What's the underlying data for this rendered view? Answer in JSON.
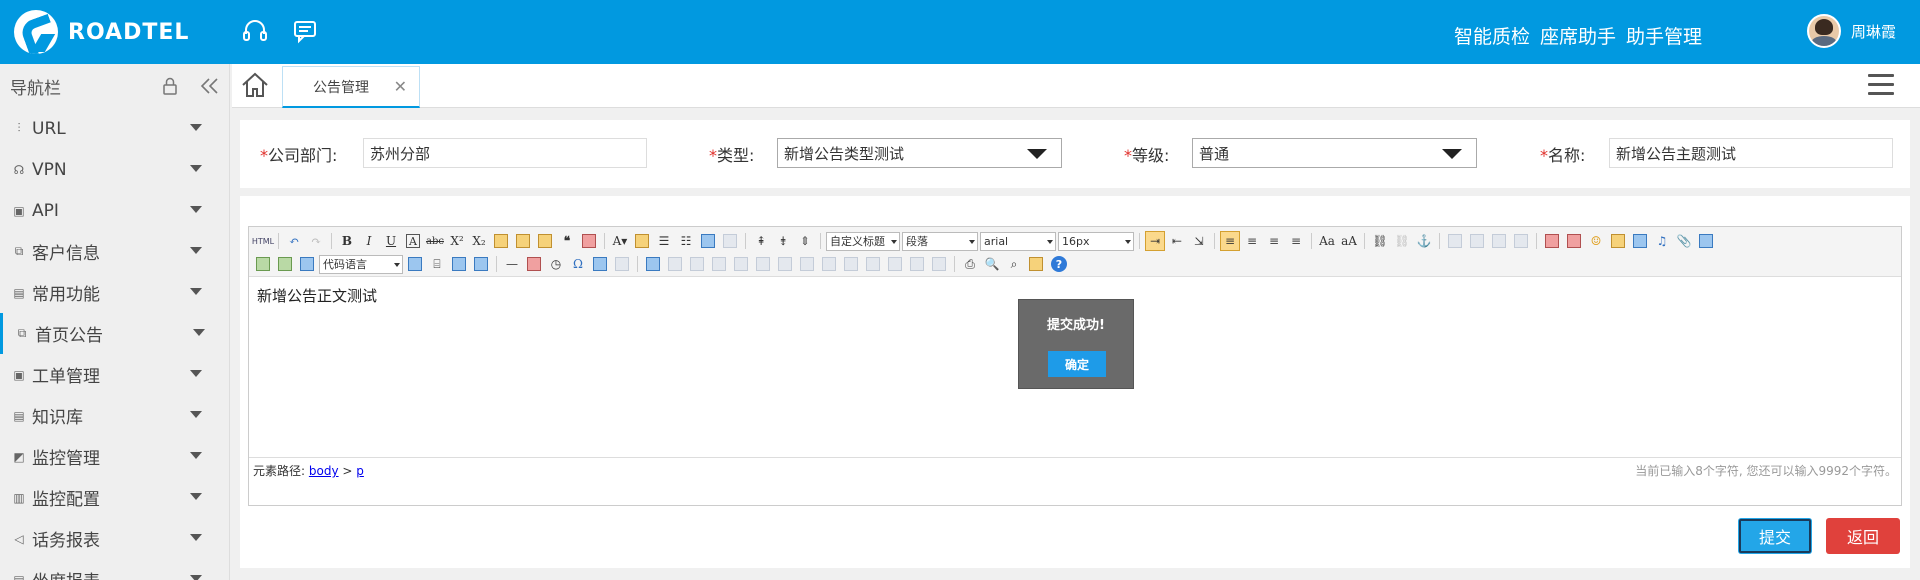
{
  "header": {
    "brand": "ROADTEL",
    "nav": [
      "智能质检",
      "座席助手",
      "助手管理"
    ],
    "user_name": "周琳霞"
  },
  "sidebar": {
    "title": "导航栏",
    "items": [
      {
        "label": "URL",
        "icon": "sliders-icon"
      },
      {
        "label": "VPN",
        "icon": "headset-icon"
      },
      {
        "label": "API",
        "icon": "image-icon"
      },
      {
        "label": "客户信息",
        "icon": "cards-icon"
      },
      {
        "label": "常用功能",
        "icon": "doc-icon"
      },
      {
        "label": "首页公告",
        "icon": "cards-icon",
        "active": true
      },
      {
        "label": "工单管理",
        "icon": "image-icon"
      },
      {
        "label": "知识库",
        "icon": "doc-icon"
      },
      {
        "label": "监控管理",
        "icon": "chart-icon"
      },
      {
        "label": "监控配置",
        "icon": "bars-icon"
      },
      {
        "label": "话务报表",
        "icon": "speaker-icon"
      },
      {
        "label": "坐席报表",
        "icon": "doc-icon"
      }
    ]
  },
  "tabs": [
    {
      "label": "公告管理"
    }
  ],
  "form": {
    "dept_label": "公司部门:",
    "dept_value": "苏州分部",
    "type_label": "类型:",
    "type_value": "新增公告类型测试",
    "level_label": "等级:",
    "level_value": "普通",
    "name_label": "名称:",
    "name_value": "新增公告主题测试"
  },
  "toolbar": {
    "heading_select": "自定义标题",
    "paragraph_select": "段落",
    "font_select": "arial",
    "size_select": "16px",
    "code_select": "代码语言"
  },
  "editor": {
    "content": "新增公告正文测试",
    "path_prefix": "元素路径:",
    "path_body": "body",
    "path_sep": ">",
    "path_p": "p",
    "count_text": "当前已输入8个字符, 您还可以输入9992个字符。"
  },
  "buttons": {
    "submit": "提交",
    "back": "返回"
  },
  "dialog": {
    "message": "提交成功!",
    "ok": "确定"
  },
  "colors": {
    "header_bg": "#0199e0",
    "submit_bg": "#23a6e8",
    "back_bg": "#e0413c"
  }
}
